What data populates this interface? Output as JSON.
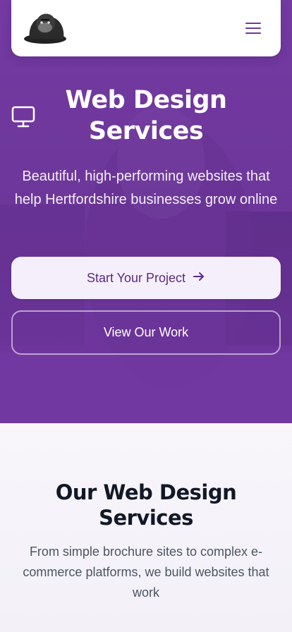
{
  "nav": {
    "logo": "gorilla-logo",
    "menu_icon": "hamburger-menu-icon"
  },
  "hero": {
    "icon": "monitor-icon",
    "title": "Web Design Services",
    "subtitle": "Beautiful, high-performing websites that help Hertfordshire businesses grow online",
    "primary_button": "Start Your Project",
    "primary_button_icon": "arrow-right-icon",
    "secondary_button": "View Our Work"
  },
  "services": {
    "title": "Our Web Design Services",
    "subtitle": "From simple brochure sites to complex e-commerce platforms, we build websites that work"
  },
  "colors": {
    "brand_purple": "#6e3a9a",
    "button_text": "#5b2a86",
    "heading_dark": "#111827"
  }
}
